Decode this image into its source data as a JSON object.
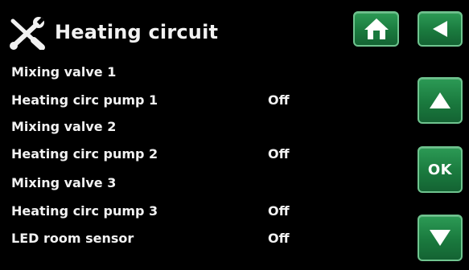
{
  "header": {
    "title": "Heating circuit",
    "icon": "tools-icon"
  },
  "nav": {
    "home_icon": "home-icon",
    "back_icon": "back-arrow-icon",
    "up_icon": "up-arrow-icon",
    "ok_label": "OK",
    "down_icon": "down-arrow-icon"
  },
  "rows": [
    {
      "label": "Mixing valve 1",
      "value": ""
    },
    {
      "label": "Heating circ pump 1",
      "value": "Off"
    },
    {
      "label": "Mixing valve 2",
      "value": ""
    },
    {
      "label": "Heating circ pump 2",
      "value": "Off"
    },
    {
      "label": "Mixing valve 3",
      "value": ""
    },
    {
      "label": "Heating circ pump 3",
      "value": "Off"
    },
    {
      "label": "LED room sensor",
      "value": "Off"
    }
  ],
  "colors": {
    "button": "#1a7a3e",
    "text": "#f2f2f2",
    "background": "#000000"
  }
}
